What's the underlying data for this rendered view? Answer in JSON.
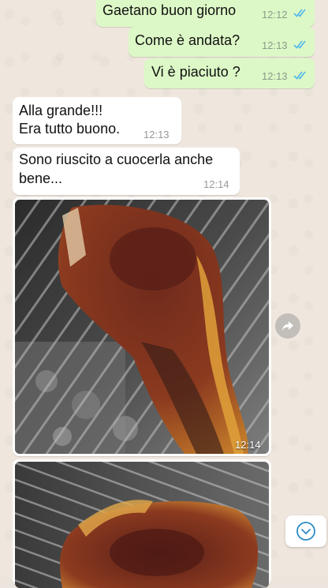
{
  "messages": [
    {
      "direction": "out",
      "text": "Gaetano buon giorno",
      "time": "12:12",
      "status": "read"
    },
    {
      "direction": "out",
      "text": "Come è andata?",
      "time": "12:13",
      "status": "read"
    },
    {
      "direction": "out",
      "text": "Vi è piaciuto ?",
      "time": "12:13",
      "status": "read"
    },
    {
      "direction": "in",
      "lines": [
        "Alla grande!!!",
        "Era tutto buono."
      ],
      "time": "12:13"
    },
    {
      "direction": "in",
      "lines": [
        "Sono riuscito a cuocerla anche",
        "bene..."
      ],
      "time": "12:14"
    },
    {
      "direction": "in",
      "type": "photo",
      "subject": "grilled tomahawk steak",
      "time": "12:14"
    },
    {
      "direction": "in",
      "type": "photo",
      "subject": "grilled steak"
    }
  ],
  "colors": {
    "outgoing": "#dcf8c6",
    "incoming": "#ffffff",
    "read_ticks": "#4fb6ec"
  },
  "icons": {
    "forward": "forward-icon",
    "scroll_down": "chevron-down-icon",
    "read": "double-check-icon"
  }
}
